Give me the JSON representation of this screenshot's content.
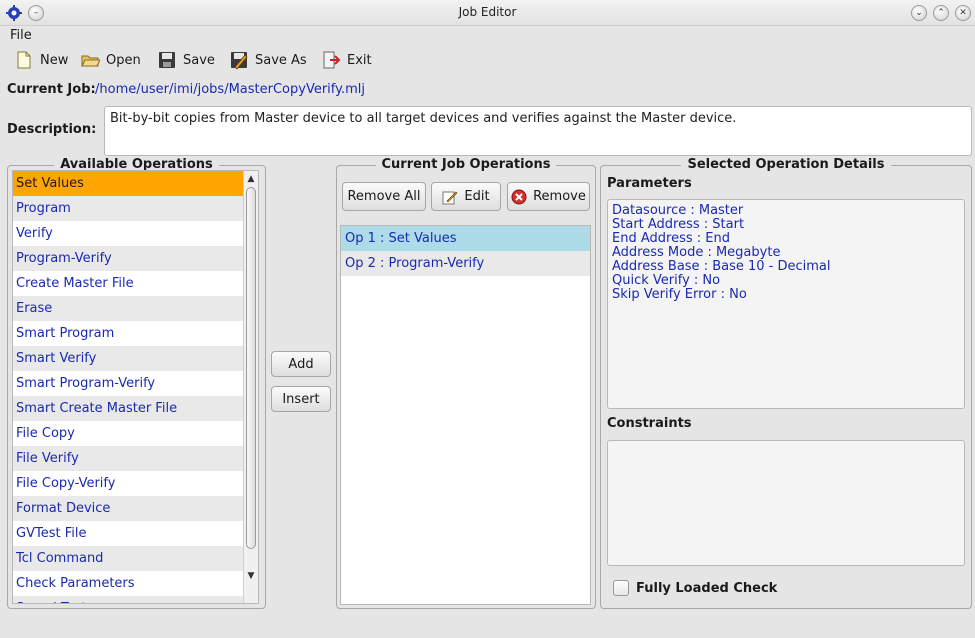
{
  "window": {
    "title": "Job Editor"
  },
  "menu": {
    "file": "File"
  },
  "toolbar": {
    "new": "New",
    "open": "Open",
    "save": "Save",
    "save_as": "Save As",
    "exit": "Exit"
  },
  "job": {
    "current_label": "Current Job:",
    "current_path": "/home/user/imi/jobs/MasterCopyVerify.mlj",
    "description_label": "Description:",
    "description": "Bit-by-bit copies from Master device to all target devices and verifies against the Master device."
  },
  "available": {
    "title": "Available Operations",
    "items": [
      "Set Values",
      "Program",
      "Verify",
      "Program-Verify",
      "Create Master File",
      "Erase",
      "Smart Program",
      "Smart Verify",
      "Smart Program-Verify",
      "Smart Create Master File",
      "File Copy",
      "File Verify",
      "File Copy-Verify",
      "Format Device",
      "GVTest File",
      "Tcl Command",
      "Check Parameters",
      "Speed Test"
    ]
  },
  "middle": {
    "add": "Add",
    "insert": "Insert"
  },
  "current_ops": {
    "title": "Current Job Operations",
    "remove_all": "Remove All",
    "edit": "Edit",
    "remove": "Remove",
    "items": [
      "Op 1 : Set Values",
      "Op 2 : Program-Verify"
    ]
  },
  "details": {
    "title": "Selected Operation Details",
    "parameters_label": "Parameters",
    "parameters": [
      "Datasource : Master",
      "Start Address : Start",
      "End Address : End",
      "Address Mode : Megabyte",
      "Address Base : Base 10 - Decimal",
      "Quick Verify : No",
      "Skip Verify Error : No"
    ],
    "constraints_label": "Constraints",
    "fully_loaded_check": "Fully Loaded Check",
    "fully_loaded_checked": false
  },
  "colors": {
    "selected_available": "#ffa500",
    "selected_current": "#aedbe8",
    "link_text": "#1a2ab0"
  }
}
